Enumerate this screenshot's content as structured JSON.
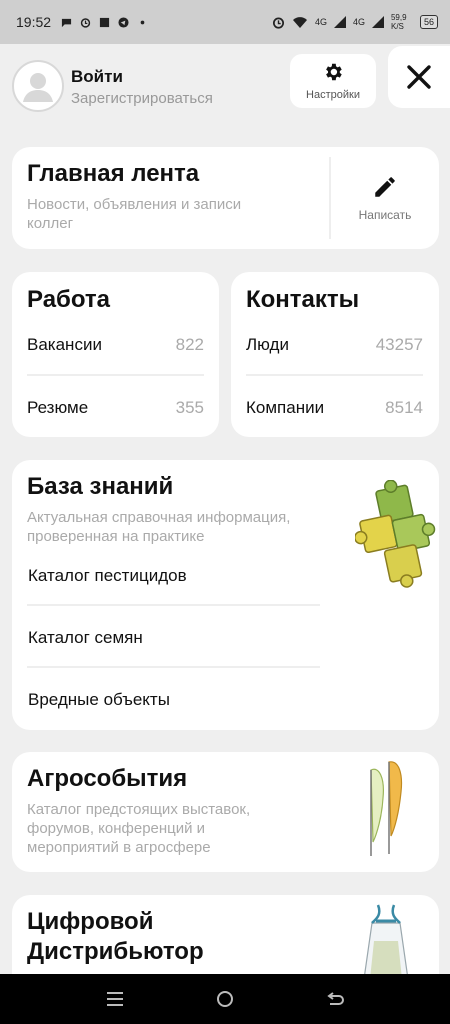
{
  "status_bar": {
    "time": "19:52",
    "net1": "4G",
    "net2": "4G",
    "speed": "59,9 K/S",
    "battery": "56"
  },
  "header": {
    "login_title": "Войти",
    "login_subtitle": "Зарегистрироваться",
    "settings_label": "Настройки"
  },
  "feed": {
    "title": "Главная лента",
    "description": "Новости, объявления и записи коллег",
    "write_label": "Написать"
  },
  "work": {
    "title": "Работа",
    "items": [
      {
        "label": "Вакансии",
        "count": "822"
      },
      {
        "label": "Резюме",
        "count": "355"
      }
    ]
  },
  "contacts": {
    "title": "Контакты",
    "items": [
      {
        "label": "Люди",
        "count": "43257"
      },
      {
        "label": "Компании",
        "count": "8514"
      }
    ]
  },
  "knowledge": {
    "title": "База знаний",
    "description": "Актуальная справочная информация, проверенная на практике",
    "links": [
      "Каталог пестицидов",
      "Каталог семян",
      "Вредные объекты"
    ]
  },
  "events": {
    "title": "Агрособытия",
    "description": "Каталог предстоящих выставок, форумов, конференций и мероприятий в агросфере"
  },
  "distributor": {
    "title_line1": "Цифровой",
    "title_line2": "Дистрибьютор"
  },
  "colors": {
    "background": "#efefef",
    "card": "#ffffff",
    "muted_text": "#aaaaaa",
    "nav_bar": "#000000",
    "puzzle_green": "#8fb84a",
    "puzzle_yellow": "#e3d34a"
  }
}
